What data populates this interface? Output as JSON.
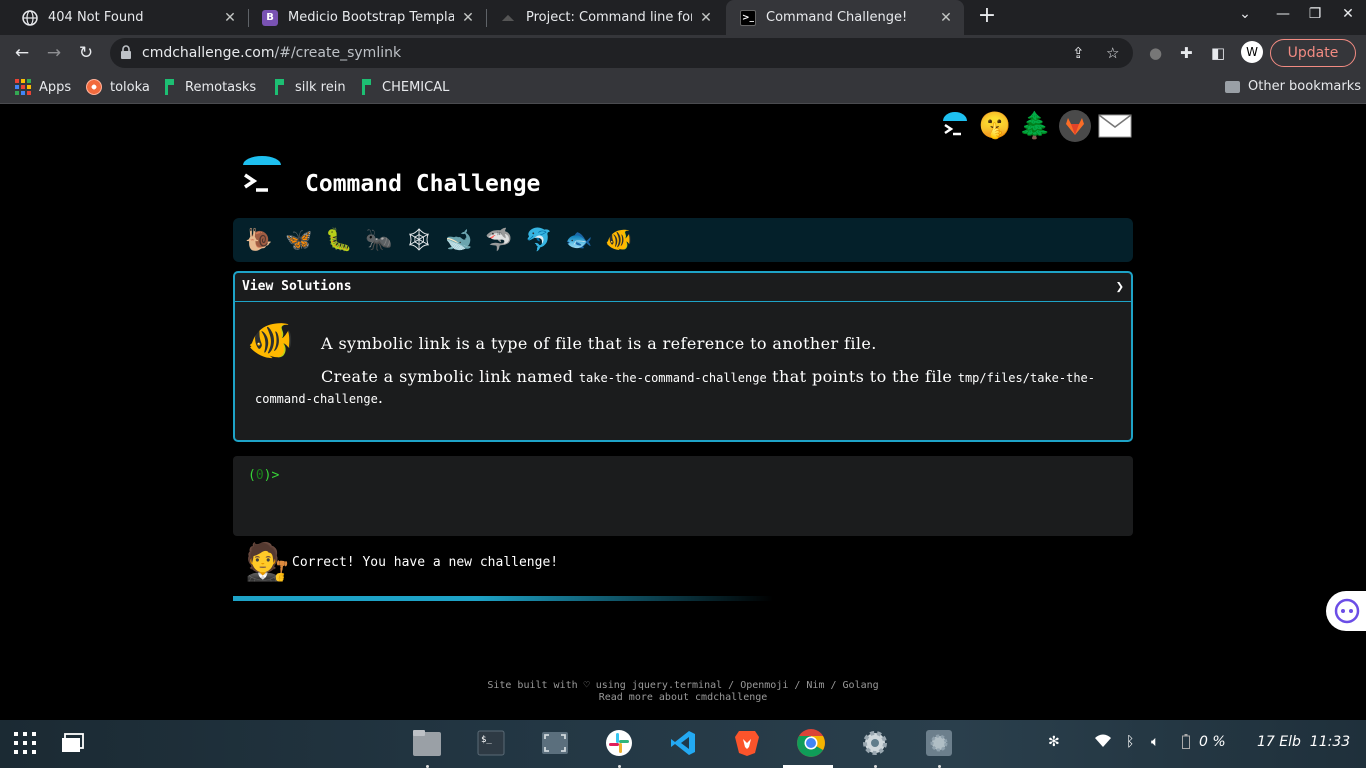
{
  "browser": {
    "tabs": [
      {
        "title": "404 Not Found",
        "favicon": "globe-icon"
      },
      {
        "title": "Medicio Bootstrap Template",
        "favicon": "bootstrap-icon"
      },
      {
        "title": "Project: Command line for th",
        "favicon": "github-icon"
      },
      {
        "title": "Command Challenge!",
        "favicon": "terminal-icon",
        "active": true
      }
    ],
    "url_host": "cmdchallenge.com",
    "url_path": "/#/create_symlink",
    "update_label": "Update",
    "bookmarks": [
      {
        "label": "Apps",
        "icon": "apps-grid-icon"
      },
      {
        "label": "toloka",
        "icon": "toloka-icon"
      },
      {
        "label": "Remotasks",
        "icon": "remotasks-icon"
      },
      {
        "label": "silk rein",
        "icon": "remotasks-icon"
      },
      {
        "label": "CHEMICAL",
        "icon": "remotasks-icon"
      }
    ],
    "other_bookmarks": "Other bookmarks"
  },
  "page": {
    "title": "Command Challenge",
    "top_links": [
      "terminal-icon",
      "shushing-face-icon",
      "tree-icon",
      "gitlab-icon",
      "mail-icon"
    ],
    "levels": [
      "snail-icon",
      "butterfly-icon",
      "caterpillar-icon",
      "ant-icon",
      "spider-web-icon",
      "whale-icon",
      "shark-icon",
      "dolphin-icon",
      "fish-icon",
      "tropical-fish-icon"
    ],
    "challenge": {
      "header": "View Solutions",
      "line1": "A symbolic link is a type of file that is a reference to another file.",
      "line2_pre": "Create a symbolic link named ",
      "line2_code1": "take-the-command-challenge",
      "line2_mid": " that points to the file ",
      "line2_code2": "tmp/files/take-the-command-challenge",
      "line2_post": "."
    },
    "terminal": {
      "prompt_open": "(",
      "prompt_num": "0",
      "prompt_close": ")>"
    },
    "result_message": "Correct! You have a new challenge!",
    "footer_line1": "Site built with ♡ using jquery.terminal / Openmoji / Nim / Golang",
    "footer_line2": "Read more about cmdchallenge"
  },
  "taskbar": {
    "battery": "0 %",
    "datetime": "17 Elb  11:33"
  },
  "colors": {
    "accent": "#1ea3c7",
    "prompt_green": "#37d437",
    "update_red": "#f28b82"
  }
}
